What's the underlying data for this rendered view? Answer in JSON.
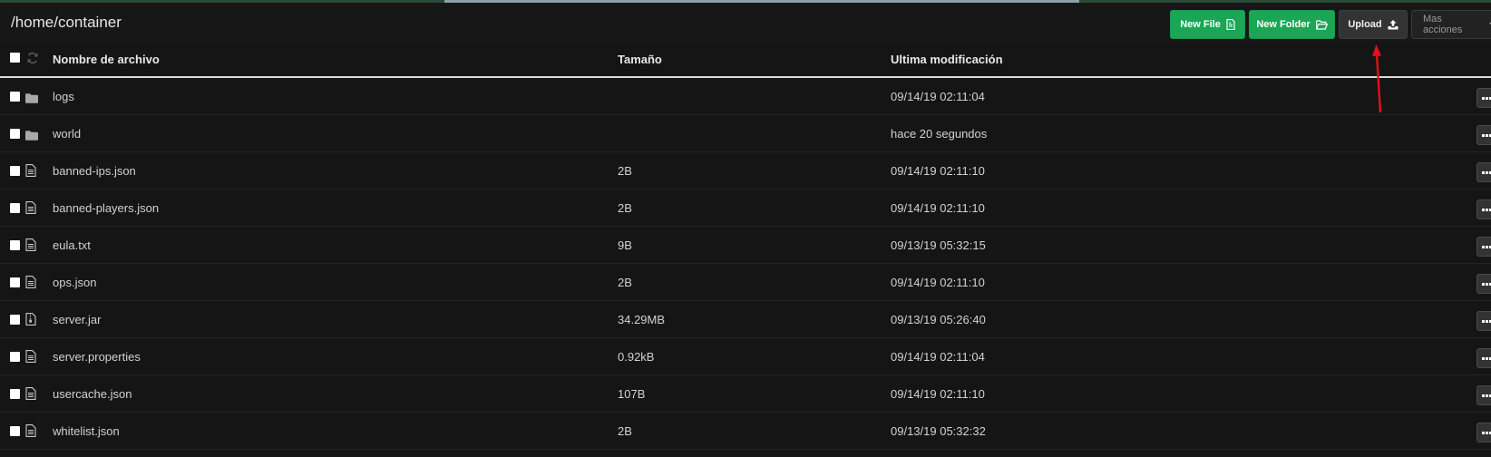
{
  "header": {
    "path": "/home/container",
    "buttons": {
      "new_file": "New File",
      "new_folder": "New Folder",
      "upload": "Upload",
      "more_actions": "Mas acciones"
    }
  },
  "table": {
    "columns": {
      "name": "Nombre de archivo",
      "size": "Tamaño",
      "modified": "Ultima modificación"
    },
    "rows": [
      {
        "name": "logs",
        "size": "",
        "modified": "09/14/19 02:11:04",
        "icon": "folder-icon"
      },
      {
        "name": "world",
        "size": "",
        "modified": "hace 20 segundos",
        "icon": "folder-icon"
      },
      {
        "name": "banned-ips.json",
        "size": "2B",
        "modified": "09/14/19 02:11:10",
        "icon": "file-text-icon"
      },
      {
        "name": "banned-players.json",
        "size": "2B",
        "modified": "09/14/19 02:11:10",
        "icon": "file-text-icon"
      },
      {
        "name": "eula.txt",
        "size": "9B",
        "modified": "09/13/19 05:32:15",
        "icon": "file-text-icon"
      },
      {
        "name": "ops.json",
        "size": "2B",
        "modified": "09/14/19 02:11:10",
        "icon": "file-text-icon"
      },
      {
        "name": "server.jar",
        "size": "34.29MB",
        "modified": "09/13/19 05:26:40",
        "icon": "file-archive-icon"
      },
      {
        "name": "server.properties",
        "size": "0.92kB",
        "modified": "09/14/19 02:11:04",
        "icon": "file-text-icon"
      },
      {
        "name": "usercache.json",
        "size": "107B",
        "modified": "09/14/19 02:11:10",
        "icon": "file-text-icon"
      },
      {
        "name": "whitelist.json",
        "size": "2B",
        "modified": "09/13/19 05:32:32",
        "icon": "file-text-icon"
      }
    ]
  },
  "colors": {
    "background": "#151515",
    "green_button": "#1aa655",
    "annotation_arrow": "#e0101a"
  }
}
